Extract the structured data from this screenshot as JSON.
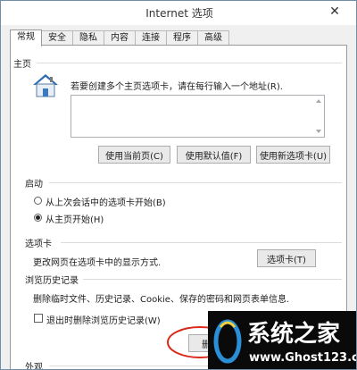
{
  "window": {
    "title": "Internet 选项",
    "close_label": "✕"
  },
  "tabs": [
    "常规",
    "安全",
    "隐私",
    "内容",
    "连接",
    "程序",
    "高级"
  ],
  "home": {
    "section": "主页",
    "description": "若要创建多个主页选项卡，请在每行输入一个地址(R).",
    "url_value": "",
    "buttons": [
      "使用当前页(C)",
      "使用默认值(F)",
      "使用新选项卡(U)"
    ]
  },
  "startup": {
    "section": "启动",
    "options": [
      "从上次会话中的选项卡开始(B)",
      "从主页开始(H)"
    ],
    "selected": 1
  },
  "tabs_section": {
    "section": "选项卡",
    "description": "更改网页在选项卡中的显示方式.",
    "button": "选项卡(T)"
  },
  "history": {
    "section": "浏览历史记录",
    "description": "删除临时文件、历史记录、Cookie、保存的密码和网页表单信息.",
    "checkbox": "退出时删除浏览历史记录(W)",
    "checked": false,
    "delete_button": "删除"
  },
  "appearance": {
    "section": "外观"
  },
  "watermark": {
    "name": "系统之家",
    "url": "www.Ghost123.com"
  }
}
